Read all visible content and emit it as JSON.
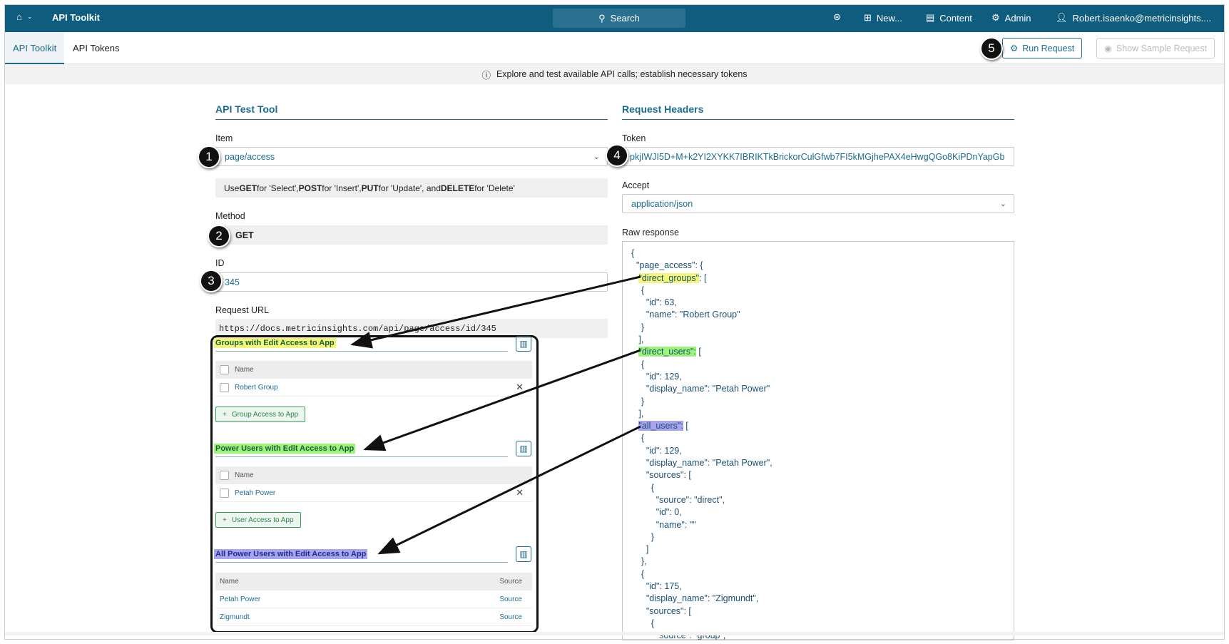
{
  "topbar": {
    "title": "API Toolkit",
    "search": "Search",
    "new": "New...",
    "content": "Content",
    "admin": "Admin",
    "user": "Robert.isaenko@metricinsights...."
  },
  "tabs": [
    {
      "label": "API Toolkit"
    },
    {
      "label": "API Tokens"
    }
  ],
  "actions": {
    "run": "Run Request",
    "sample": "Show Sample Request"
  },
  "info": "Explore and test available API calls; establish necessary tokens",
  "left": {
    "title": "API Test Tool",
    "item_label": "Item",
    "item_value": "page/access",
    "hint": {
      "p1": "Use ",
      "get": "GET",
      "p2": " for 'Select', ",
      "post": "POST",
      "p3": " for 'Insert', ",
      "put": "PUT",
      "p4": " for 'Update', and ",
      "del": "DELETE",
      "p5": " for 'Delete'"
    },
    "method_label": "Method",
    "method_value": "GET",
    "id_label": "ID",
    "id_value": "345",
    "url_label": "Request URL",
    "url_value": "https://docs.metricinsights.com/api/page/access/id/345"
  },
  "right": {
    "title": "Request Headers",
    "token_label": "Token",
    "token_value": "pkjIWJI5D+M+k2YI2XYKK7IBRIKTkBrickorCulGfwb7FI5kMGjhePAX4eHwgQGo8KiPDnYapGb",
    "accept_label": "Accept",
    "accept_value": "application/json",
    "raw_label": "Raw response"
  },
  "raw_lines": [
    {
      "t": "{"
    },
    {
      "t": "  \"page_access\": {"
    },
    {
      "pre": "   ",
      "hl": "\"direct_groups\"",
      "post": ": [",
      "c": "#f5f77a"
    },
    {
      "t": "    {"
    },
    {
      "t": "      \"id\": 63,"
    },
    {
      "t": "      \"name\": \"Robert Group\""
    },
    {
      "t": "    }"
    },
    {
      "t": "   ],"
    },
    {
      "pre": "   ",
      "hl": "\"direct_users\":",
      "post": " [",
      "c": "#9cf57a"
    },
    {
      "t": "    {"
    },
    {
      "t": "      \"id\": 129,"
    },
    {
      "t": "      \"display_name\": \"Petah Power\""
    },
    {
      "t": "    }"
    },
    {
      "t": "   ],"
    },
    {
      "pre": "   ",
      "hl": "\"all_users\":",
      "post": " [",
      "c": "#a9a4f0"
    },
    {
      "t": "    {"
    },
    {
      "t": "      \"id\": 129,"
    },
    {
      "t": "      \"display_name\": \"Petah Power\","
    },
    {
      "t": "      \"sources\": ["
    },
    {
      "t": "        {"
    },
    {
      "t": "          \"source\": \"direct\","
    },
    {
      "t": "          \"id\": 0,"
    },
    {
      "t": "          \"name\": \"\""
    },
    {
      "t": "        }"
    },
    {
      "t": "      ]"
    },
    {
      "t": "    },"
    },
    {
      "t": "    {"
    },
    {
      "t": "      \"id\": 175,"
    },
    {
      "t": "      \"display_name\": \"Zigmundt\","
    },
    {
      "t": "      \"sources\": ["
    },
    {
      "t": "        {"
    },
    {
      "t": "          \"source\": \"group\","
    }
  ],
  "callout": {
    "groups": {
      "title": "Groups with Edit Access to App",
      "col": "Name",
      "rows": [
        "Robert Group"
      ],
      "add": "Group Access to App",
      "color": "#f5f77a"
    },
    "users": {
      "title": "Power Users with Edit Access to App",
      "col": "Name",
      "rows": [
        "Petah Power"
      ],
      "add": "User Access to App",
      "color": "#9cf57a"
    },
    "all": {
      "title": "All Power Users with Edit Access to App",
      "col": "Name",
      "col2": "Source",
      "rows": [
        {
          "name": "Petah Power",
          "source": "Source"
        },
        {
          "name": "Zigmundt",
          "source": "Source"
        }
      ],
      "color": "#a9a4f0"
    }
  },
  "badges": [
    "1",
    "2",
    "3",
    "4",
    "5"
  ]
}
